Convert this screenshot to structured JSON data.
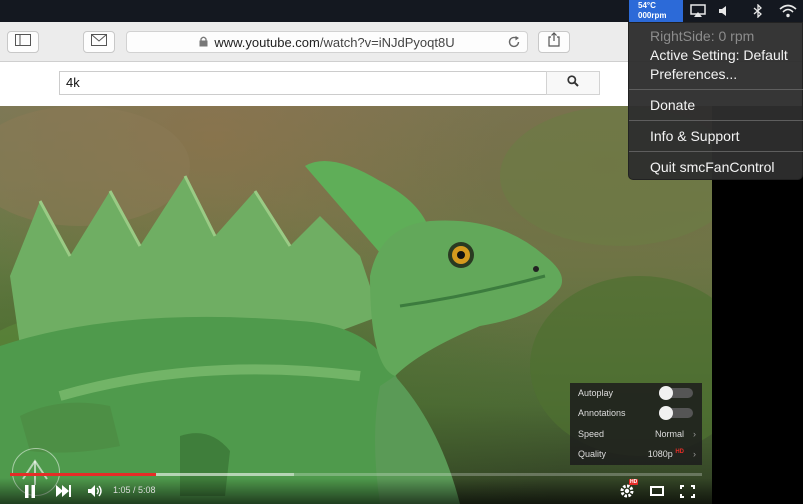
{
  "menubar": {
    "fan_temp": "54°C",
    "fan_rpm": "000rpm",
    "icons": [
      "airplay-icon",
      "volume-icon",
      "bluetooth-icon",
      "wifi-icon"
    ]
  },
  "fan_menu": {
    "right_side": "RightSide: 0 rpm",
    "active_setting": "Active Setting: Default",
    "preferences": "Preferences...",
    "donate": "Donate",
    "info_support": "Info & Support",
    "quit": "Quit smcFanControl"
  },
  "toolbar": {
    "url_prefix": "www.youtube.com",
    "url_rest": "/watch?v=iNJdPyoqt8U",
    "icons": [
      "sidebar-icon",
      "mail-icon",
      "lock-icon",
      "reload-icon",
      "share-icon"
    ]
  },
  "search": {
    "value": "4k"
  },
  "player": {
    "time": "1:05 / 5:08",
    "progress_played": 0.211,
    "progress_buffered": 0.41,
    "settings": {
      "autoplay_label": "Autoplay",
      "autoplay_on": false,
      "annotations_label": "Annotations",
      "annotations_on": false,
      "speed_label": "Speed",
      "speed_value": "Normal",
      "quality_label": "Quality",
      "quality_value": "1080p",
      "quality_badge": "HD"
    },
    "settings_badge": "HD"
  },
  "colors": {
    "accent": "#e52d27",
    "menubar": "#141820",
    "fan_status": "#2c6ad8"
  }
}
